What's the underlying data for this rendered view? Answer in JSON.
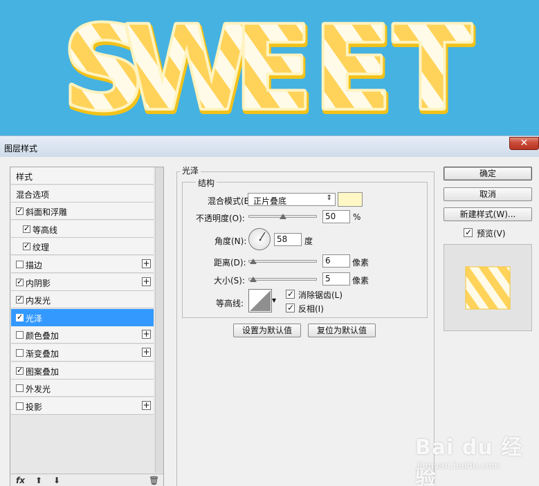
{
  "banner": {
    "text": "SWEET"
  },
  "dialog": {
    "title": "图层样式",
    "close_label": "✕",
    "styles_list": [
      {
        "label": "样式",
        "checkbox": false,
        "checked": false,
        "plus": false,
        "indent": 0,
        "selected": false
      },
      {
        "label": "混合选项",
        "checkbox": false,
        "checked": false,
        "plus": false,
        "indent": 0,
        "selected": false
      },
      {
        "label": "斜面和浮雕",
        "checkbox": true,
        "checked": true,
        "plus": false,
        "indent": 0,
        "selected": false
      },
      {
        "label": "等高线",
        "checkbox": true,
        "checked": true,
        "plus": false,
        "indent": 1,
        "selected": false
      },
      {
        "label": "纹理",
        "checkbox": true,
        "checked": true,
        "plus": false,
        "indent": 1,
        "selected": false
      },
      {
        "label": "描边",
        "checkbox": true,
        "checked": false,
        "plus": true,
        "indent": 0,
        "selected": false
      },
      {
        "label": "内阴影",
        "checkbox": true,
        "checked": true,
        "plus": true,
        "indent": 0,
        "selected": false
      },
      {
        "label": "内发光",
        "checkbox": true,
        "checked": true,
        "plus": false,
        "indent": 0,
        "selected": false
      },
      {
        "label": "光泽",
        "checkbox": true,
        "checked": true,
        "plus": false,
        "indent": 0,
        "selected": true
      },
      {
        "label": "颜色叠加",
        "checkbox": true,
        "checked": false,
        "plus": true,
        "indent": 0,
        "selected": false
      },
      {
        "label": "渐变叠加",
        "checkbox": true,
        "checked": false,
        "plus": true,
        "indent": 0,
        "selected": false
      },
      {
        "label": "图案叠加",
        "checkbox": true,
        "checked": true,
        "plus": false,
        "indent": 0,
        "selected": false
      },
      {
        "label": "外发光",
        "checkbox": true,
        "checked": false,
        "plus": false,
        "indent": 0,
        "selected": false
      },
      {
        "label": "投影",
        "checkbox": true,
        "checked": false,
        "plus": true,
        "indent": 0,
        "selected": false
      }
    ],
    "footer": {
      "fx": "fx",
      "up": "⬆",
      "down": "⬇",
      "trash": "🗑"
    },
    "satin": {
      "section_title": "光泽",
      "structure_title": "结构",
      "blend_mode_label": "混合模式(B):",
      "blend_mode_value": "正片叠底",
      "blend_color": "#fff8c6",
      "opacity_label": "不透明度(O):",
      "opacity_value": "50",
      "opacity_unit": "%",
      "opacity_fraction": 0.5,
      "angle_label": "角度(N):",
      "angle_value": "58",
      "angle_unit": "度",
      "distance_label": "距离(D):",
      "distance_value": "6",
      "distance_unit": "像素",
      "size_label": "大小(S):",
      "size_value": "5",
      "size_unit": "像素",
      "contour_label": "等高线:",
      "antialias_label": "消除锯齿(L)",
      "antialias_checked": true,
      "invert_label": "反相(I)",
      "invert_checked": true,
      "set_default_label": "设置为默认值",
      "reset_default_label": "复位为默认值"
    },
    "right": {
      "ok_label": "确定",
      "cancel_label": "取消",
      "new_style_label": "新建样式(W)...",
      "preview_label": "预览(V)",
      "preview_checked": true
    }
  },
  "watermark": {
    "brand": "Bai du 经验",
    "url": "jingyan.baidu.com"
  },
  "colors": {
    "banner_bg": "#45b2e2",
    "selected": "#3399ff",
    "candy_yellow": "#ffd84a"
  }
}
